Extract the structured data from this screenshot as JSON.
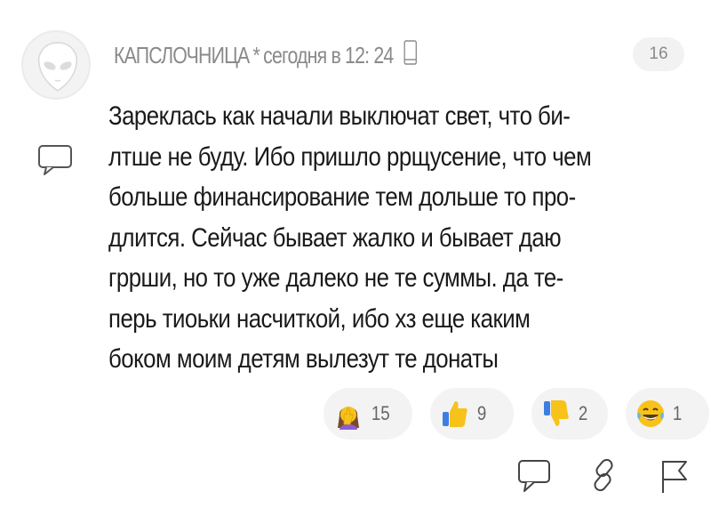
{
  "comment": {
    "author": "КАПСЛОЧНИЦА",
    "separator": "*",
    "timestamp": "сегодня в 12: 24",
    "rating": "16",
    "avatar_icon": "alien-avatar-icon",
    "text_lines": [
      "Зареклась как начали выключат свет, что би-",
      "лтше не буду. Ибо пришло ррщусение, что чем",
      "больше финансирование тем дольше то про-",
      "длится. Сейчас бывает жалко и бывает даю",
      "гррши, но то уже далеко не те суммы. да те-",
      "перь тиоьки насчиткой, ибо хз еще каким",
      "боком моим детям вылезут те донаты"
    ]
  },
  "reactions": [
    {
      "icon": "facepalm-woman-icon",
      "count": "15"
    },
    {
      "icon": "thumbs-up-icon",
      "count": "9"
    },
    {
      "icon": "thumbs-down-icon",
      "count": "2"
    },
    {
      "icon": "laughing-tears-icon",
      "count": "1"
    }
  ],
  "actions": {
    "reply_icon": "speech-bubble-icon",
    "link_icon": "link-icon",
    "flag_icon": "flag-icon"
  },
  "colors": {
    "meta_text": "#8a8a8a",
    "body_text": "#1a1a1a",
    "pill_bg": "#f3f3f3",
    "emoji_yellow": "#f7c21a"
  }
}
